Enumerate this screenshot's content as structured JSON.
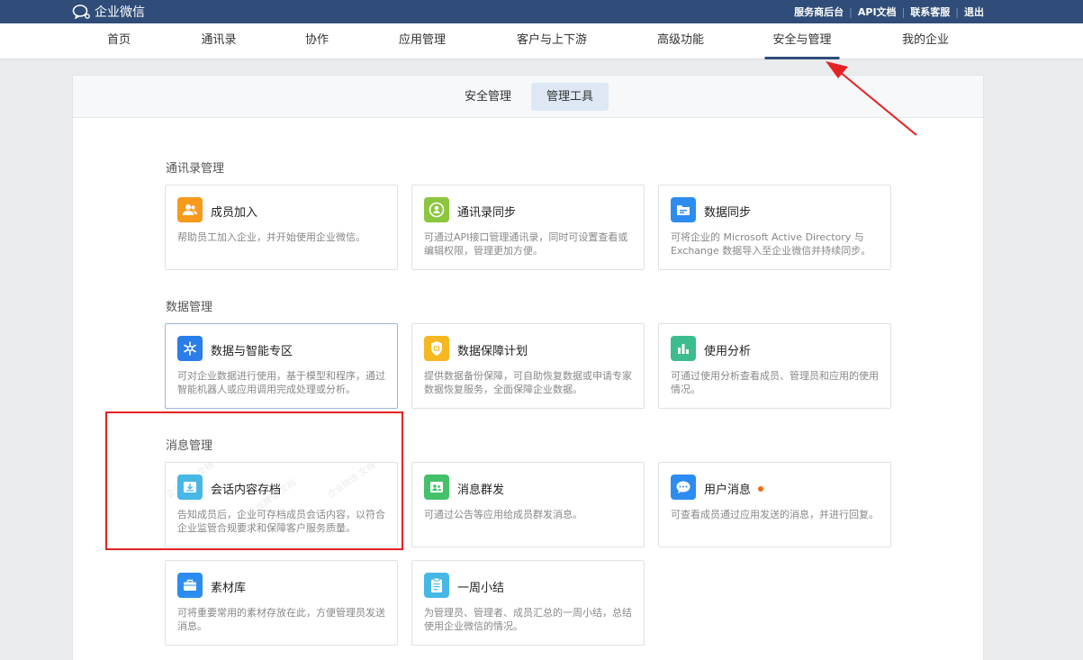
{
  "topbar": {
    "logo_text": "企业微信",
    "links": [
      "服务商后台",
      "API文档",
      "联系客服",
      "退出"
    ]
  },
  "nav": {
    "items": [
      "首页",
      "通讯录",
      "协作",
      "应用管理",
      "客户与上下游",
      "高级功能",
      "安全与管理",
      "我的企业"
    ],
    "active": "安全与管理"
  },
  "subtabs": {
    "security": "安全管理",
    "tools": "管理工具",
    "active": "管理工具"
  },
  "sections": {
    "contacts": "通讯录管理",
    "data": "数据管理",
    "messages": "消息管理"
  },
  "cards": {
    "member_join": {
      "title": "成员加入",
      "desc": "帮助员工加入企业，并开始使用企业微信。",
      "icon": "member-join-icon",
      "color": "#f79a1c"
    },
    "contact_sync": {
      "title": "通讯录同步",
      "desc": "可通过API接口管理通讯录，同时可设置查看或编辑权限，管理更加方便。",
      "icon": "contact-sync-icon",
      "color": "#8cc63f"
    },
    "data_sync": {
      "title": "数据同步",
      "desc": "可将企业的 Microsoft Active Directory 与 Exchange 数据导入至企业微信并持续同步。",
      "icon": "data-sync-icon",
      "color": "#2d8cf0"
    },
    "data_ai": {
      "title": "数据与智能专区",
      "desc": "可对企业数据进行使用，基于模型和程序，通过智能机器人或应用调用完成处理或分析。",
      "icon": "snowflake-icon",
      "color": "#2b7de9"
    },
    "data_backup": {
      "title": "数据保障计划",
      "desc": "提供数据备份保障，可自助恢复数据或申请专家数据恢复服务，全面保障企业数据。",
      "icon": "shield-icon",
      "color": "#f5b820"
    },
    "usage": {
      "title": "使用分析",
      "desc": "可通过使用分析查看成员、管理员和应用的使用情况。",
      "icon": "bar-chart-icon",
      "color": "#3cbd8d"
    },
    "archive": {
      "title": "会话内容存档",
      "desc": "告知成员后，企业可存档成员会话内容，以符合企业监管合规要求和保障客户服务质量。",
      "icon": "archive-icon",
      "color": "#47b8e6"
    },
    "mass_msg": {
      "title": "消息群发",
      "desc": "可通过公告等应用给成员群发消息。",
      "icon": "mass-message-icon",
      "color": "#45c16a"
    },
    "user_msg": {
      "title": "用户消息",
      "desc": "可查看成员通过应用发送的消息，并进行回复。",
      "icon": "chat-bubble-icon",
      "color": "#2d8cf0"
    },
    "materials": {
      "title": "素材库",
      "desc": "可将重要常用的素材存放在此，方便管理员发送消息。",
      "icon": "briefcase-icon",
      "color": "#2d8cf0"
    },
    "weekly": {
      "title": "一周小结",
      "desc": "为管理员、管理者、成员汇总的一周小结，总结使用企业微信的情况。",
      "icon": "clipboard-icon",
      "color": "#47b8e6"
    }
  },
  "annotation_color": "#e52222"
}
